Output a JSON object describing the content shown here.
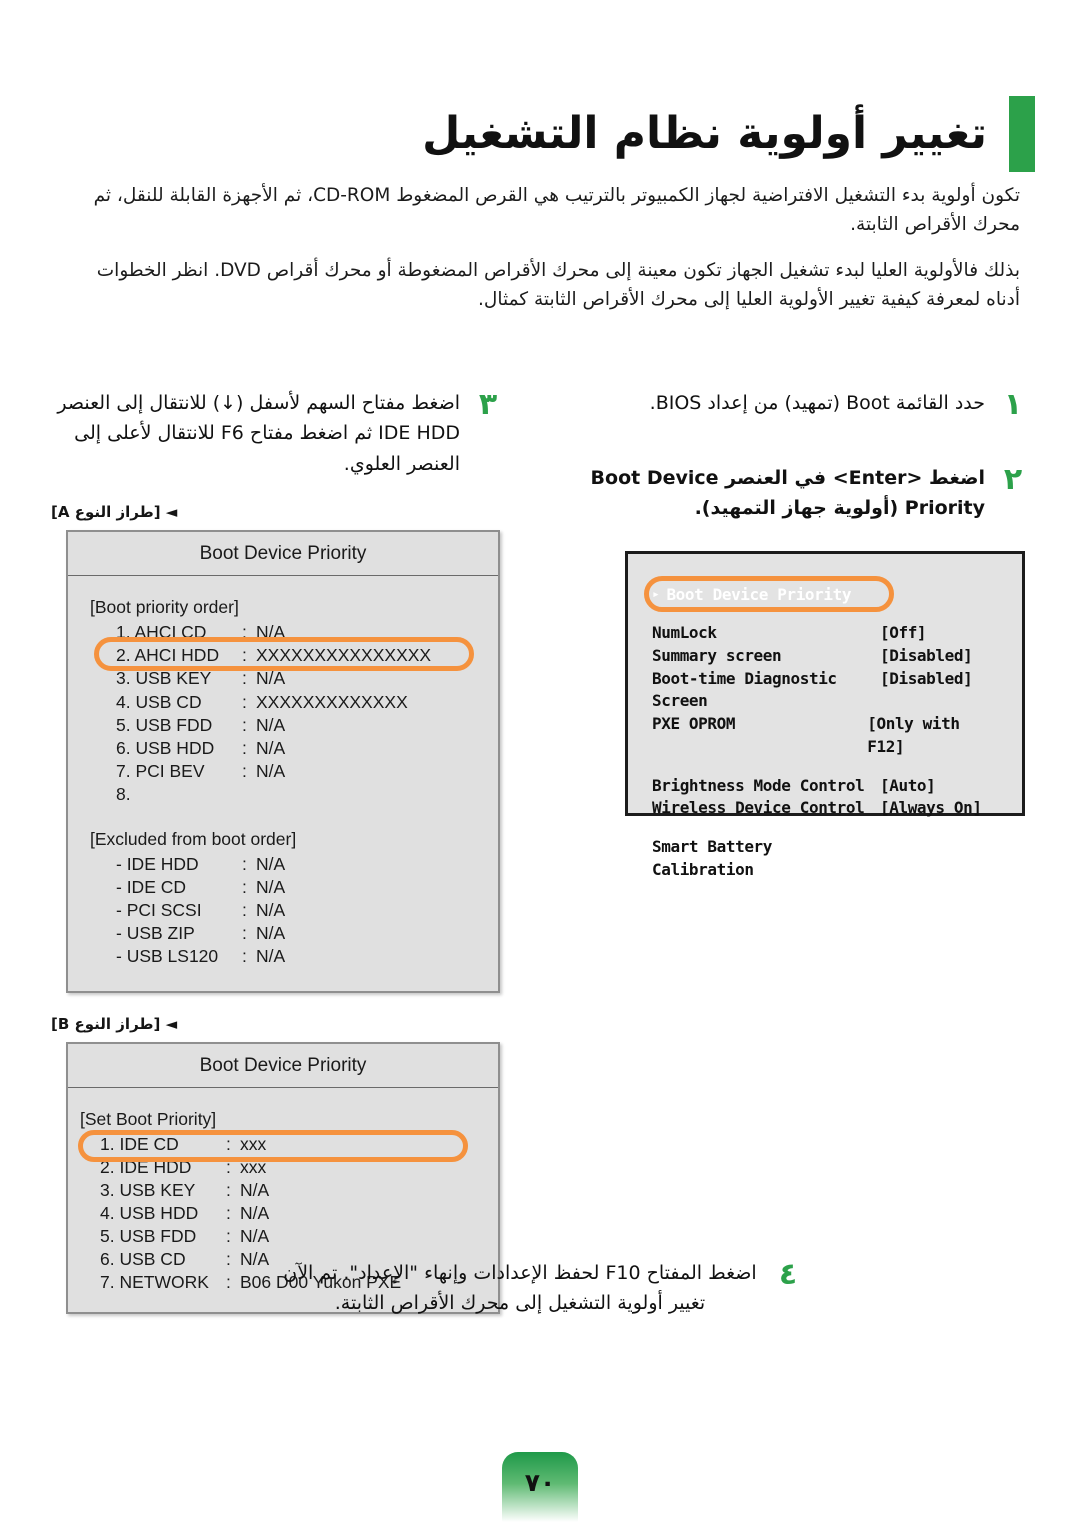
{
  "header": {
    "title": "تغيير أولوية نظام التشغيل",
    "accent_color": "#2ca14a"
  },
  "intro": {
    "paragraph_1": "تكون أولوية بدء التشغيل الافتراضية لجهاز الكمبيوتر بالترتيب هي القرص المضغوط CD-ROM، ثم الأجهزة القابلة للنقل، ثم محرك الأقراص الثابتة.",
    "paragraph_2": "بذلك فالأولوية العليا لبدء تشغيل الجهاز تكون معينة إلى محرك الأقراص المضغوطة أو محرك أقراص DVD. انظر الخطوات أدناه لمعرفة كيفية تغيير الأولوية العليا إلى محرك الأقراص الثابتة كمثال."
  },
  "steps": {
    "step1": {
      "number": "١",
      "text": "حدد القائمة Boot (تمهيد) من إعداد BIOS."
    },
    "step2": {
      "number": "٢",
      "line1": "اضغط <Enter> في العنصر Boot Device",
      "line2": "Priority (أولوية جهاز التمهيد)."
    },
    "step3": {
      "number": "٣",
      "text": "اضغط مفتاح السهم لأسفل (↓) للانتقال إلى العنصر IDE HDD ثم اضغط مفتاح F6 للانتقال لأعلى إلى العنصر العلوي."
    },
    "step4": {
      "number": "٤",
      "text": "اضغط المفتاح F10 لحفظ الإعدادات وإنهاء \"الإعداد\". تم الآن تغيير أولوية التشغيل إلى محرك الأقراص الثابتة."
    }
  },
  "bios_dark": {
    "highlight_color": "#f5923e",
    "highlighted_item": "Boot Device Priority",
    "bullet": "▸",
    "rows": [
      {
        "label": "NumLock",
        "value": "[Off]"
      },
      {
        "label": "Summary screen",
        "value": "[Disabled]"
      },
      {
        "label": "Boot-time Diagnostic Screen",
        "value": "[Disabled]"
      },
      {
        "label": "PXE OPROM",
        "value": "[Only with F12]"
      }
    ],
    "rows2": [
      {
        "label": "Brightness Mode Control",
        "value": "[Auto]"
      },
      {
        "label": "Wireless Device Control",
        "value": "[Always On]"
      }
    ],
    "rows3": [
      {
        "label": "Smart Battery Calibration",
        "value": ""
      }
    ]
  },
  "variant_a": {
    "caption": "◄ [طراز النوع A]",
    "title": "Boot Device Priority",
    "section1_head": "[Boot priority order]",
    "section1_rows": [
      {
        "key": "1. AHCI CD",
        "sep": ":",
        "value": "N/A"
      },
      {
        "key": "2. AHCI HDD",
        "sep": ":",
        "value": "XXXXXXXXXXXXXXX"
      },
      {
        "key": "3. USB KEY",
        "sep": ":",
        "value": "N/A"
      },
      {
        "key": "4. USB CD",
        "sep": ":",
        "value": "XXXXXXXXXXXXX"
      },
      {
        "key": "5. USB FDD",
        "sep": ":",
        "value": "N/A"
      },
      {
        "key": "6. USB HDD",
        "sep": ":",
        "value": "N/A"
      },
      {
        "key": "7. PCI BEV",
        "sep": ":",
        "value": "N/A"
      },
      {
        "key": "8.",
        "sep": "",
        "value": ""
      }
    ],
    "section2_head": "[Excluded from boot order]",
    "section2_rows": [
      {
        "key": "- IDE HDD",
        "sep": ":",
        "value": "N/A"
      },
      {
        "key": "- IDE CD",
        "sep": ":",
        "value": "N/A"
      },
      {
        "key": "- PCI SCSI",
        "sep": ":",
        "value": "N/A"
      },
      {
        "key": "- USB ZIP",
        "sep": ":",
        "value": "N/A"
      },
      {
        "key": "- USB LS120",
        "sep": ":",
        "value": "N/A"
      }
    ],
    "highlighted_row_index": 1
  },
  "variant_b": {
    "caption": "◄ [طراز النوع B]",
    "title": "Boot Device Priority",
    "section1_head": "[Set Boot Priority]",
    "section1_rows": [
      {
        "key": "1. IDE CD",
        "sep": ":",
        "value": "xxx"
      },
      {
        "key": "2. IDE HDD",
        "sep": ":",
        "value": "xxx"
      },
      {
        "key": "3. USB KEY",
        "sep": ":",
        "value": "N/A"
      },
      {
        "key": "4. USB HDD",
        "sep": ":",
        "value": "N/A"
      },
      {
        "key": "5. USB FDD",
        "sep": ":",
        "value": "N/A"
      },
      {
        "key": "6. USB CD",
        "sep": ":",
        "value": "N/A"
      },
      {
        "key": "7. NETWORK",
        "sep": ":",
        "value": "B06 D00 Yukon PXE"
      }
    ],
    "highlighted_row_index": 0
  },
  "footer": {
    "page_number": "٧٠"
  }
}
